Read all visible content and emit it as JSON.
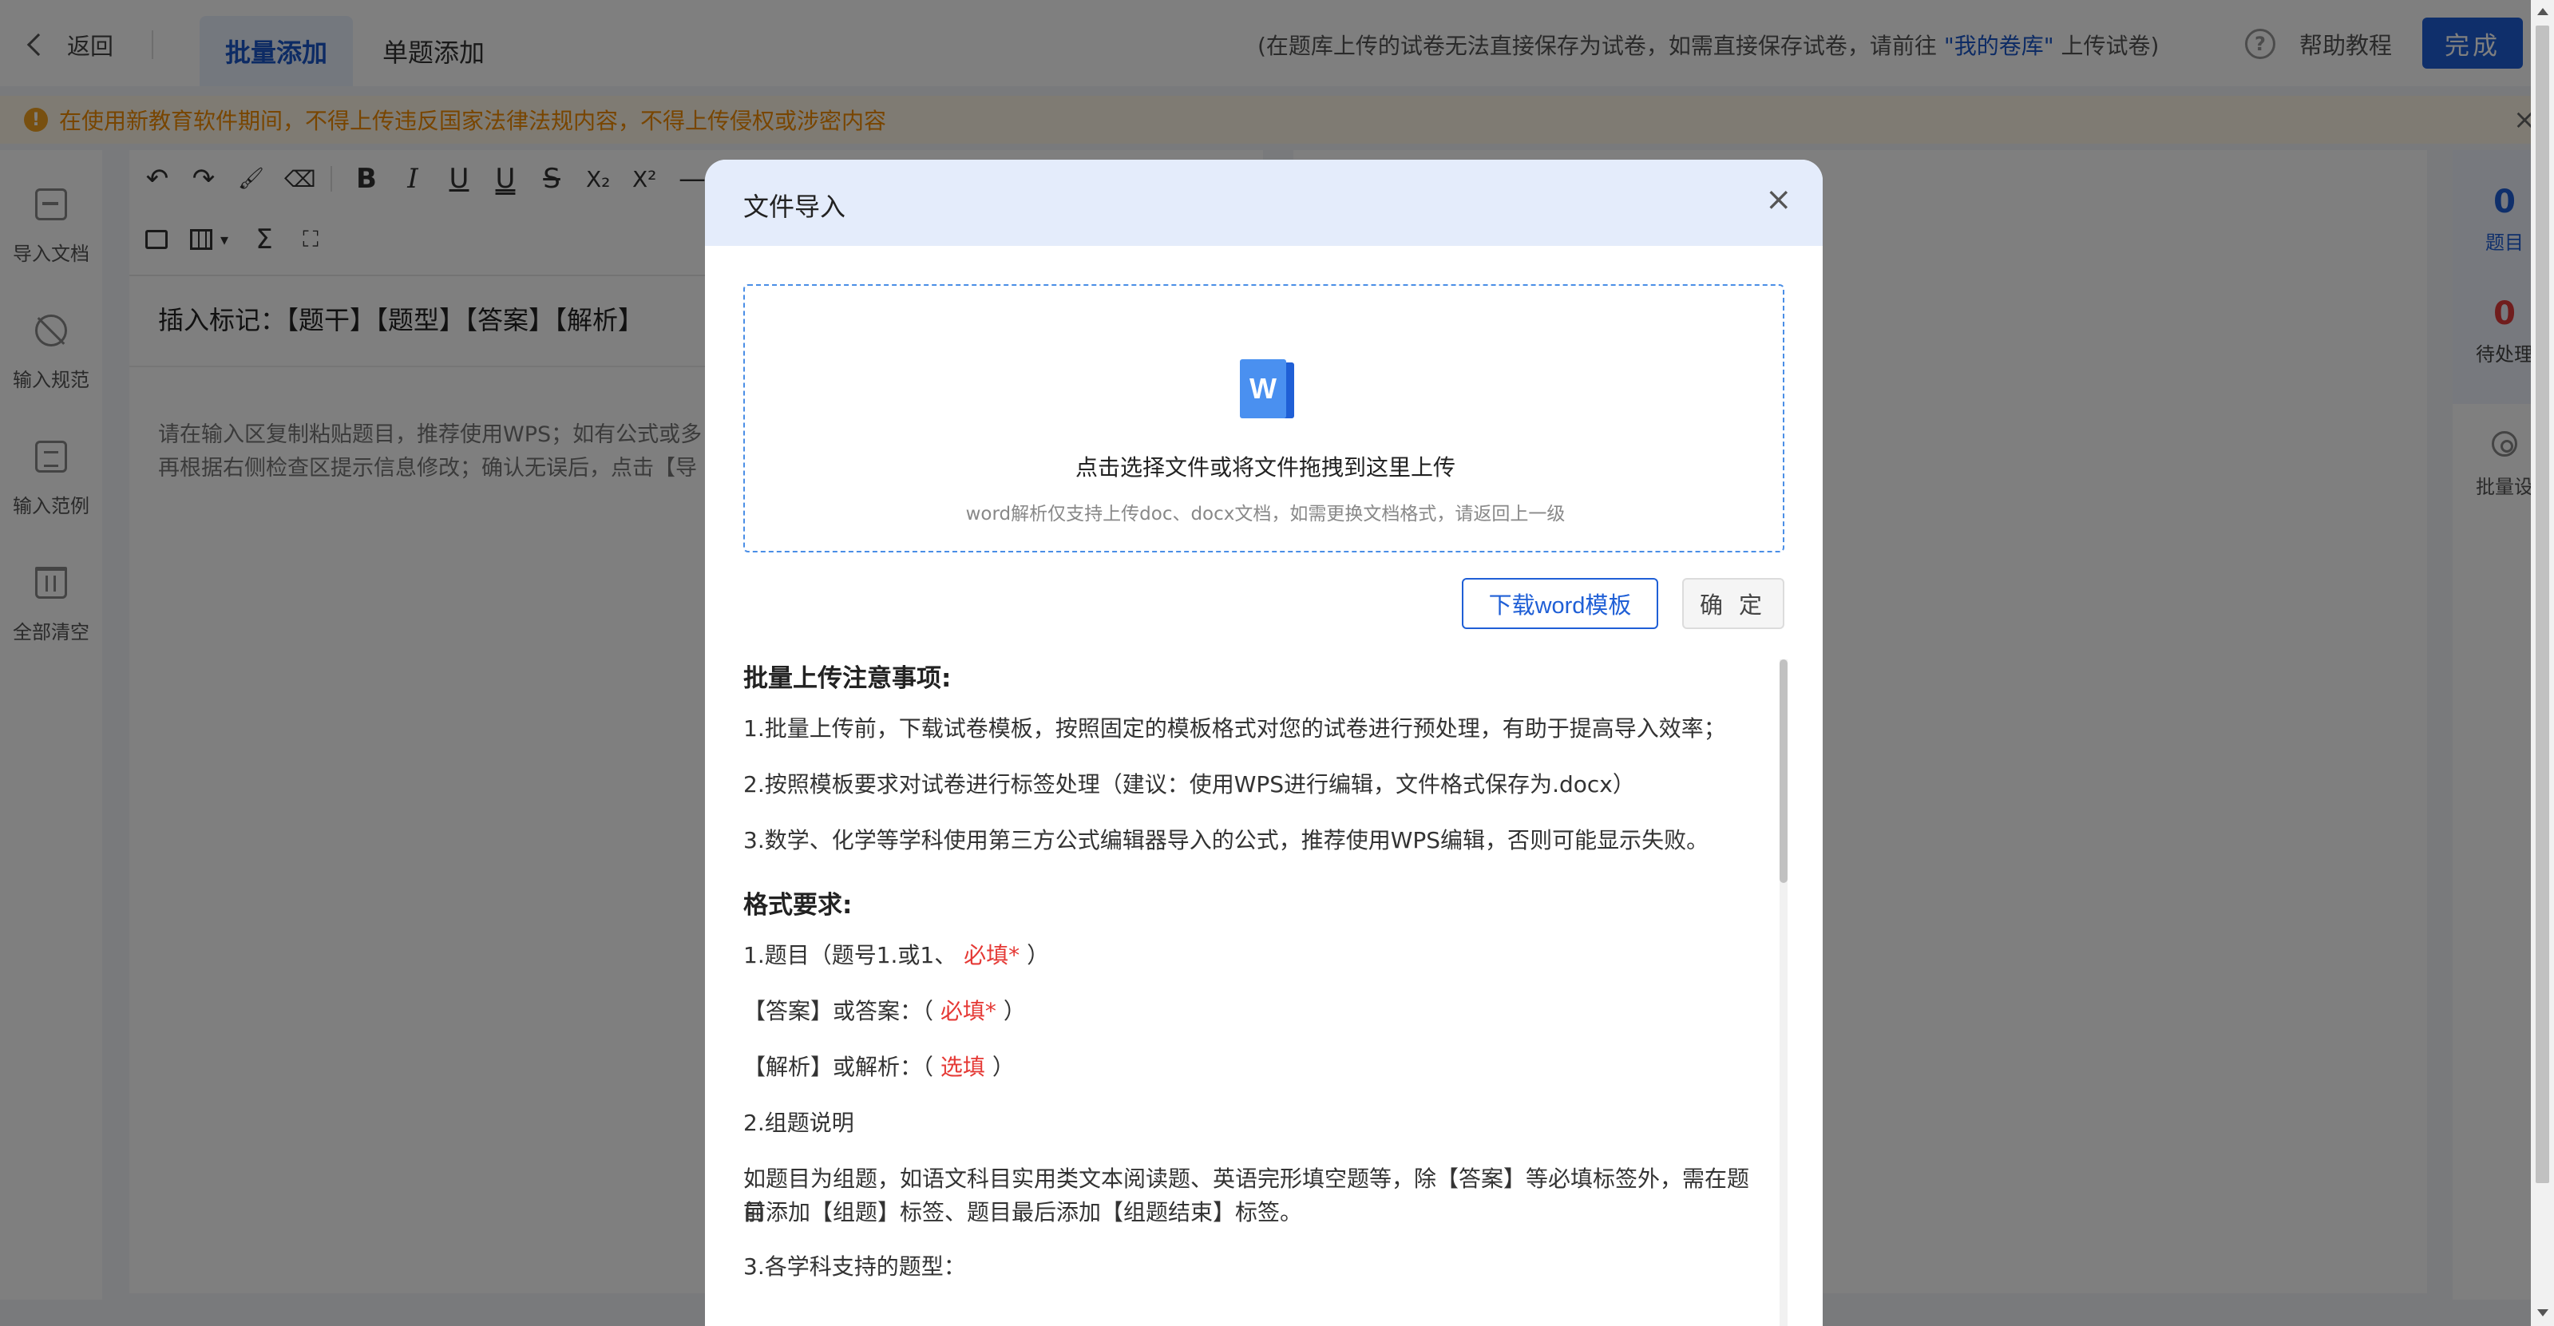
{
  "topbar": {
    "back_label": "返回",
    "tabs": [
      {
        "label": "批量添加",
        "active": true
      },
      {
        "label": "单题添加",
        "active": false
      }
    ],
    "notice_prefix": "(在题库上传的试卷无法直接保存为试卷，如需直接保存试卷，请前往",
    "notice_link": "\"我的卷库\"",
    "notice_suffix": "上传试卷)",
    "help_label": "帮助教程",
    "done_label": "完成"
  },
  "warning": {
    "text": "在使用新教育软件期间，不得上传违反国家法律法规内容，不得上传侵权或涉密内容",
    "close": "×"
  },
  "left_rail": [
    {
      "label": "导入文档",
      "icon": "import-doc-icon"
    },
    {
      "label": "输入规范",
      "icon": "input-rule-icon"
    },
    {
      "label": "输入范例",
      "icon": "input-example-icon"
    },
    {
      "label": "全部清空",
      "icon": "trash-icon"
    }
  ],
  "editor": {
    "toolbar": {
      "undo": "↶",
      "redo": "↷",
      "format_brush": "🖌",
      "eraser": "⌫",
      "bold": "B",
      "italic": "I",
      "underline": "U",
      "double_underline": "U",
      "strikethrough": "S",
      "subscript": "X₂",
      "superscript": "X²",
      "dash": "—",
      "formula": "Σ",
      "capture": "⛶",
      "table_caret": "▾"
    },
    "insert_marks": "插入标记：【题干】【题型】【答案】【解析】",
    "placeholder_line1": "请在输入区复制粘贴题目，推荐使用WPS；如有公式或多",
    "placeholder_line2": "再根据右侧检查区提示信息修改；确认无误后，点击【导"
  },
  "right_rail": {
    "count_questions": "0",
    "count_questions_label": "题目",
    "count_pending": "0",
    "count_pending_label": "待处理",
    "batch_label": "批量设"
  },
  "modal": {
    "title": "文件导入",
    "close": "×",
    "dropzone_main": "点击选择文件或将文件拖拽到这里上传",
    "dropzone_sub": "word解析仅支持上传doc、docx文档，如需更换文档格式，请返回上一级",
    "word_letter": "W",
    "download_template": "下载word模板",
    "confirm": "确 定",
    "notes_title": "批量上传注意事项:",
    "note1": "1.批量上传前，下载试卷模板，按照固定的模板格式对您的试卷进行预处理，有助于提高导入效率；",
    "note2": "2.按照模板要求对试卷进行标签处理（建议：使用WPS进行编辑，文件格式保存为.docx）",
    "note3": "3.数学、化学等学科使用第三方公式编辑器导入的公式，推荐使用WPS编辑，否则可能显示失败。",
    "format_title": "格式要求:",
    "fmt1_prefix": "1.题目（题号1.或1、",
    "fmt1_req": "必填*",
    "fmt1_suffix": "）",
    "fmt2_prefix": "【答案】或答案：（",
    "fmt2_req": "必填*",
    "fmt2_suffix": "）",
    "fmt3_prefix": "【解析】或解析：（",
    "fmt3_opt": "选填",
    "fmt3_suffix": "）",
    "group_title": "2.组题说明",
    "group_line1": "如题目为组题，如语文科目实用类文本阅读题、英语完形填空题等，除【答案】等必填标签外，需在题目",
    "group_line2": "前添加【组题】标签、题目最后添加【组题结束】标签。",
    "subjects_title": "3.各学科支持的题型："
  },
  "colors": {
    "accent": "#1f5fd6",
    "required": "#e53935",
    "warning": "#f08a00",
    "modal_header": "#e4ecfb"
  }
}
